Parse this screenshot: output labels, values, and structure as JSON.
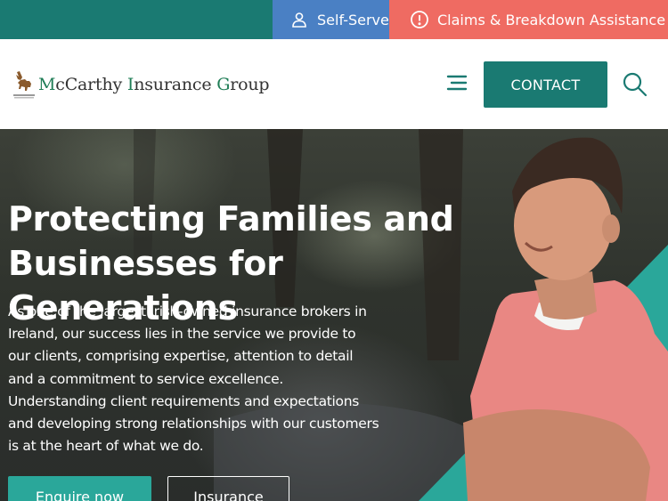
{
  "topbar": {
    "self_serve_label": "Self-Serve",
    "claims_label": "Claims & Breakdown Assistance"
  },
  "header": {
    "logo": {
      "part1": "M",
      "part2": "cCarthy ",
      "part3": "I",
      "part4": "nsurance ",
      "part5": "G",
      "part6": "roup"
    },
    "contact_label": "CONTACT"
  },
  "hero": {
    "title": "Protecting Families and Businesses for Generations",
    "body": "As one of the largest Irish-owned insurance brokers in Ireland, our success lies in the service we provide to our clients, comprising expertise, attention to detail and a commitment to service excellence. Understanding client requirements and expectations and developing strong relationships with our customers is at the heart of what we do.",
    "enquire_label": "Enquire now",
    "insurance_label": "Insurance"
  },
  "icons": {
    "self_serve": "user-icon",
    "claims": "alert-circle-icon",
    "menu": "hamburger-menu-icon",
    "search": "search-icon",
    "logo": "stag-logo-icon"
  },
  "colors": {
    "topbar": "#1a7a72",
    "self_serve": "#4a80c4",
    "claims": "#ef6b62",
    "brand": "#1a7a72",
    "accent": "#2aa79a"
  }
}
